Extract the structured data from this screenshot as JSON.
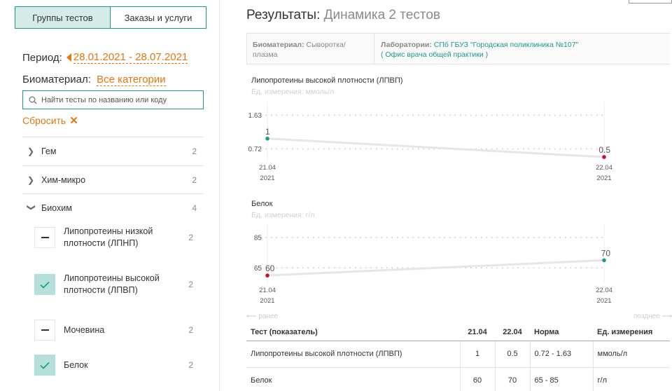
{
  "tabs": [
    {
      "label": "Группы тестов",
      "active": true
    },
    {
      "label": "Заказы и услуги",
      "active": false
    }
  ],
  "filters": {
    "period_label": "Период:",
    "period_value": "28.01.2021 - 28.07.2021",
    "biomaterial_label": "Биоматериал:",
    "biomaterial_value": "Все категории",
    "search_placeholder": "Найти тесты по названию или коду",
    "reset_label": "Сбросить"
  },
  "groups": [
    {
      "name": "Гем",
      "count": "2",
      "expanded": false
    },
    {
      "name": "Хим-микро",
      "count": "2",
      "expanded": false
    },
    {
      "name": "Биохим",
      "count": "4",
      "expanded": true
    }
  ],
  "subtests": [
    {
      "name": "Липопротеины низкой плотности (ЛПНП)",
      "count": "2",
      "state": "minus"
    },
    {
      "name": "Липопротеины высокой плотности (ЛПВП)",
      "count": "2",
      "state": "checked"
    },
    {
      "name": "Мочевина",
      "count": "2",
      "state": "minus"
    },
    {
      "name": "Белок",
      "count": "2",
      "state": "checked"
    }
  ],
  "header": {
    "title": "Результаты:",
    "subtitle": "Динамика 2 тестов"
  },
  "info": {
    "bio_label": "Биоматериал:",
    "bio_value": "Сыворотка/ плазма",
    "lab_label": "Лаборатории:",
    "lab_value_1": "СПб ГБУЗ \"Городская поликлиника №107\"",
    "lab_value_2": "( Офис врача общей практики )"
  },
  "chart_data": [
    {
      "type": "line",
      "title": "Липопротеины высокой плотности (ЛПВП)",
      "unit": "Ед. измерения: ммоль/л",
      "x": [
        "21.04 2021",
        "22.04 2021"
      ],
      "x_ticks": [
        {
          "day": "21.04",
          "year": "2021"
        },
        {
          "day": "22.04",
          "year": "2021"
        }
      ],
      "values": [
        1,
        0.5
      ],
      "value_labels": [
        "1",
        "0.5"
      ],
      "point_colors": [
        "#1a9a8a",
        "#c8102e"
      ],
      "ref_lines": [
        1.63,
        0.72
      ],
      "ref_labels": [
        "1.63",
        "0.72"
      ],
      "ylim": [
        0.35,
        1.85
      ],
      "grid": false
    },
    {
      "type": "line",
      "title": "Белок",
      "unit": "Ед. измерения: г/л",
      "x": [
        "21.04 2021",
        "22.04 2021"
      ],
      "x_ticks": [
        {
          "day": "21.04",
          "year": "2021"
        },
        {
          "day": "22.04",
          "year": "2021"
        }
      ],
      "values": [
        60,
        70
      ],
      "value_labels": [
        "60",
        "70"
      ],
      "point_colors": [
        "#c8102e",
        "#1a9a8a"
      ],
      "ref_lines": [
        85,
        65
      ],
      "ref_labels": [
        "85",
        "65"
      ],
      "ylim": [
        55,
        90
      ],
      "grid": false
    }
  ],
  "pager": {
    "prev": "ранее",
    "next": "позднее"
  },
  "table": {
    "headers": [
      "Тест (показатель)",
      "21.04",
      "22.04",
      "Норма",
      "Ед. измерения"
    ],
    "rows": [
      [
        "Липопротеины высокой плотности (ЛПВП)",
        "1",
        "0.5",
        "0.72 - 1.63",
        "ммоль/л"
      ],
      [
        "Белок",
        "60",
        "70",
        "65 - 85",
        "г/л"
      ]
    ]
  },
  "colors": {
    "accent": "#1a9a8a",
    "orange": "#e4760f",
    "red": "#c8102e"
  }
}
